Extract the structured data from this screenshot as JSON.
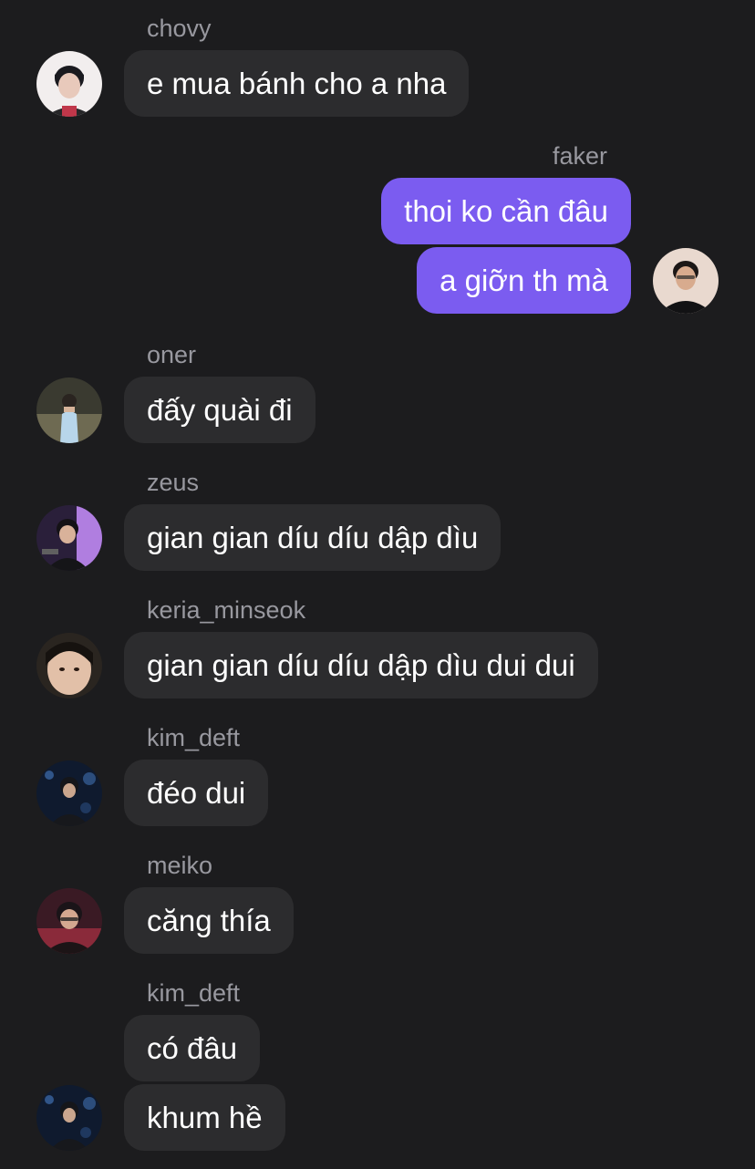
{
  "messages": [
    {
      "sender": "chovy",
      "text": "e mua bánh cho a nha"
    },
    {
      "sender": "faker",
      "texts": [
        "thoi ko cần đâu",
        "a giỡn th mà"
      ]
    },
    {
      "sender": "oner",
      "text": "đấy quài đi"
    },
    {
      "sender": "zeus",
      "text": "gian gian díu díu dập dìu"
    },
    {
      "sender": "keria_minseok",
      "text": "gian gian díu díu dập dìu dui dui"
    },
    {
      "sender": "kim_deft",
      "text": "đéo dui"
    },
    {
      "sender": "meiko",
      "text": "căng thía"
    },
    {
      "sender": "kim_deft",
      "texts": [
        "có đâu",
        "khum hề"
      ]
    }
  ],
  "colors": {
    "background": "#1c1c1e",
    "incoming_bubble": "#2c2c2e",
    "outgoing_bubble": "#7b5cf0",
    "sender_name": "#98989f",
    "message_text": "#ffffff"
  },
  "avatar_icons": [
    "user-photo-icon"
  ]
}
